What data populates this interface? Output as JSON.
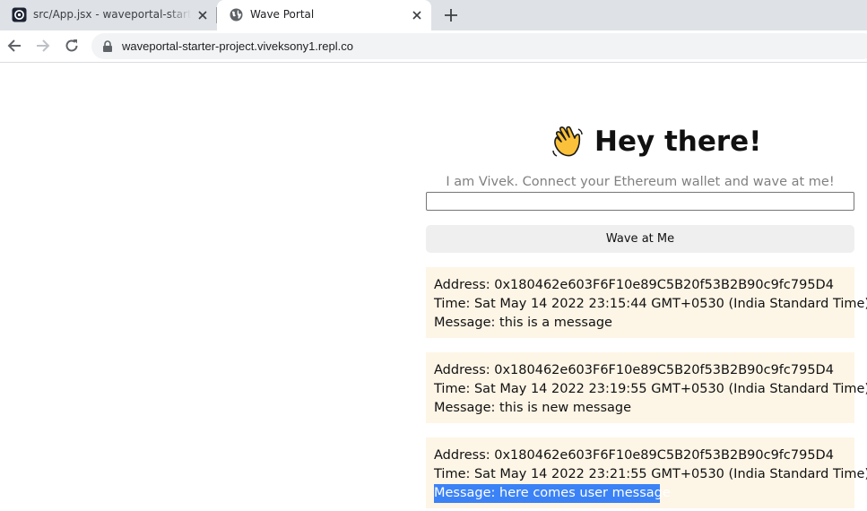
{
  "browser": {
    "tabs": [
      {
        "title": "src/App.jsx - waveportal-starter-project",
        "favicon": "replit-icon",
        "active": false
      },
      {
        "title": "Wave Portal",
        "favicon": "globe-icon",
        "active": true
      }
    ],
    "url": "waveportal-starter-project.viveksony1.repl.co"
  },
  "page": {
    "heading": "Hey there!",
    "bio": "I am Vivek. Connect your Ethereum wallet and wave at me!",
    "message_input": {
      "value": "",
      "placeholder": ""
    },
    "wave_button_label": "Wave at Me",
    "waves": [
      {
        "address": "Address: 0x180462e603F6F10e89C5B20f53B2B90c9fc795D4",
        "time": "Time: Sat May 14 2022 23:15:44 GMT+0530 (India Standard Time)",
        "message": "Message: this is a message"
      },
      {
        "address": "Address: 0x180462e603F6F10e89C5B20f53B2B90c9fc795D4",
        "time": "Time: Sat May 14 2022 23:19:55 GMT+0530 (India Standard Time)",
        "message": "Message: this is new message"
      },
      {
        "address": "Address: 0x180462e603F6F10e89C5B20f53B2B90c9fc795D4",
        "time": "Time: Sat May 14 2022 23:21:55 GMT+0530 (India Standard Time)",
        "message": "Message: here comes user message"
      }
    ]
  },
  "colors": {
    "card_background": "#fdf5e6",
    "selection": "#3b82f6",
    "tabstrip": "#dee1e6"
  }
}
